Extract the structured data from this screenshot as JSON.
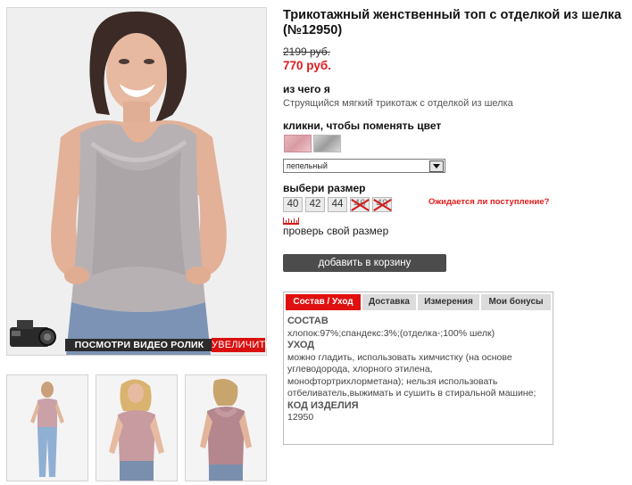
{
  "product": {
    "title": "Трикотажный женственный топ с отделкой из шелка (№12950)",
    "old_price": "2199 руб.",
    "new_price": "770 руб."
  },
  "material": {
    "heading": "из чего я",
    "description": "Струящийся мягкий трикотаж с отделкой из шелка"
  },
  "color": {
    "heading": "кликни, чтобы поменять цвет",
    "swatches": [
      "pink",
      "grey"
    ],
    "selected": "пепельный"
  },
  "size": {
    "heading": "выбери размер",
    "options": [
      {
        "label": "40",
        "available": true
      },
      {
        "label": "42",
        "available": true
      },
      {
        "label": "44",
        "available": true
      },
      {
        "label": "46",
        "available": false
      },
      {
        "label": "48",
        "available": false
      }
    ],
    "awaiting": "Ожидается ли поступление?",
    "check_label": "проверь свой размер"
  },
  "cart_button": "добавить в корзину",
  "media": {
    "video_label": "ПОСМОТРИ ВИДЕО РОЛИК",
    "zoom_label": "УВЕЛИЧИТЬ"
  },
  "tabs": {
    "items": [
      "Состав / Уход",
      "Доставка",
      "Измерения",
      "Мои бонусы"
    ],
    "active": "Состав / Уход",
    "content": {
      "composition_heading": "СОСТАВ",
      "composition": "хлопок:97%;спандекс:3%;(отделка-;100% шелк)",
      "care_heading": "УХОД",
      "care": "можно гладить, использовать химчистку (на основе углеводорода, хлорного этилена, монофтортрихлорметана); нельзя использовать отбеливатель,выжимать и сушить в стиральной машине;",
      "code_heading": "КОД ИЗДЕЛИЯ",
      "code": "12950"
    }
  },
  "colors": {
    "accent": "#e01010",
    "price_red": "#e01b1b",
    "button_dark": "#4c4c4c",
    "tab_grey": "#dcdcdc"
  }
}
